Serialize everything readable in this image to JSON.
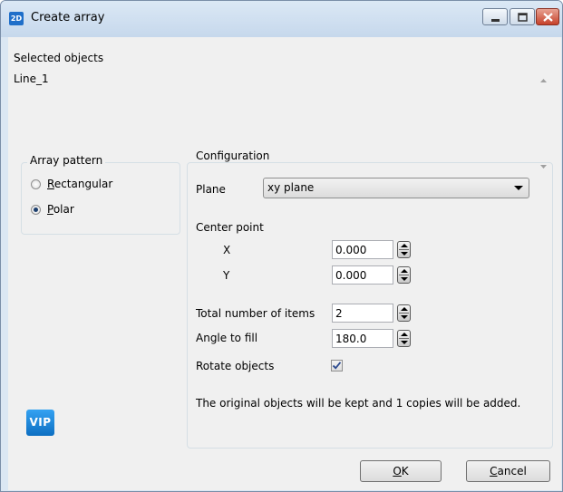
{
  "window": {
    "icon_text": "2D",
    "title": "Create array"
  },
  "selected_objects": {
    "label": "Selected objects",
    "items": [
      "Line_1"
    ]
  },
  "array_pattern": {
    "title": "Array pattern",
    "options": [
      {
        "label_pre": "",
        "mnemonic": "R",
        "label_post": "ectangular",
        "selected": false
      },
      {
        "label_pre": "",
        "mnemonic": "P",
        "label_post": "olar",
        "selected": true
      }
    ]
  },
  "configuration": {
    "title": "Configuration",
    "plane_label": "Plane",
    "plane_value": "xy plane",
    "center_point_label": "Center point",
    "x_label": "X",
    "x_value": "0.000",
    "y_label": "Y",
    "y_value": "0.000",
    "total_items_label": "Total number of items",
    "total_items_value": "2",
    "angle_label": "Angle to fill",
    "angle_value": "180.0",
    "rotate_label": "Rotate objects",
    "rotate_checked": true,
    "info_text": "The original objects will be kept and 1 copies will be added."
  },
  "badge": {
    "text": "VIP"
  },
  "buttons": {
    "ok": {
      "mnemonic": "O",
      "rest": "K"
    },
    "cancel": {
      "mnemonic": "C",
      "rest": "ancel"
    }
  },
  "colors": {
    "titlebar": "#c6d8ec",
    "dialog_bg": "#f0f0f0",
    "close_button": "#c6412a",
    "badge": "#1a86d9"
  }
}
